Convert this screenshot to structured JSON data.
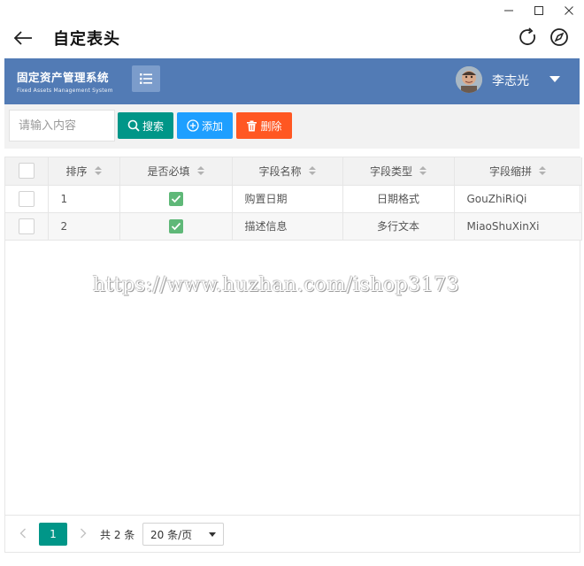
{
  "window": {
    "title": "自定表头",
    "minimize_icon": "minimize-icon",
    "maximize_icon": "maximize-icon",
    "close_icon": "close-icon",
    "back_icon": "arrow-left-icon",
    "refresh_icon": "refresh-icon",
    "compass_icon": "compass-icon"
  },
  "header": {
    "brand_cn": "固定资产管理系统",
    "brand_en": "Fixed Assets Management System",
    "menu_icon": "list-menu-icon",
    "user_name": "李志光",
    "accent_color": "#527bb5"
  },
  "toolbar": {
    "search_placeholder": "请输入内容",
    "search_label": "搜索",
    "add_label": "添加",
    "delete_label": "删除",
    "colors": {
      "search": "#009688",
      "add": "#1e9fff",
      "delete": "#ff5722"
    }
  },
  "table": {
    "columns": [
      "排序",
      "是否必填",
      "字段名称",
      "字段类型",
      "字段缩拼"
    ],
    "rows": [
      {
        "order": "1",
        "required": true,
        "name": "购置日期",
        "type": "日期格式",
        "abbr": "GouZhiRiQi"
      },
      {
        "order": "2",
        "required": true,
        "name": "描述信息",
        "type": "多行文本",
        "abbr": "MiaoShuXinXi"
      }
    ]
  },
  "watermark": "https://www.huzhan.com/ishop3173",
  "pager": {
    "current_page": "1",
    "total_text": "共 2 条",
    "page_size": "20 条/页"
  }
}
